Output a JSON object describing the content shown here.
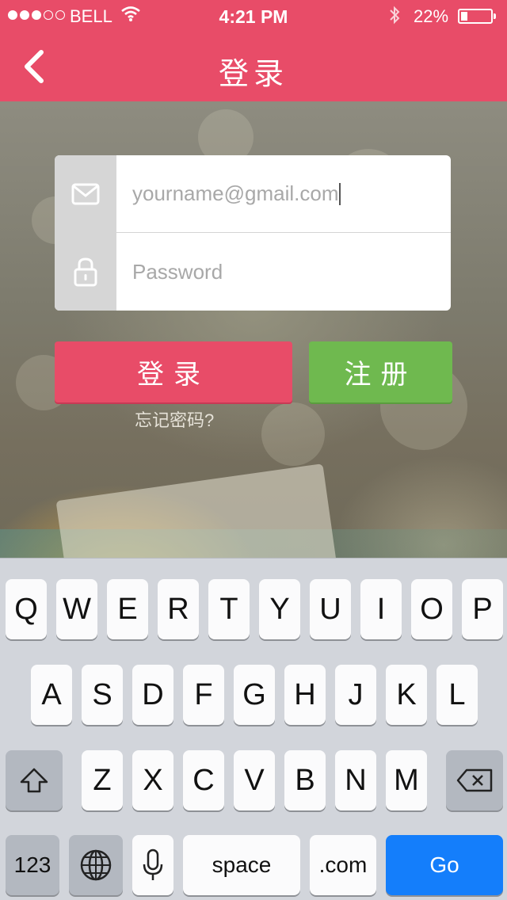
{
  "status_bar": {
    "carrier": "BELL",
    "time": "4:21 PM",
    "battery_percent": "22%",
    "battery_level": 0.22,
    "signal_bars_filled": 3,
    "signal_bars_total": 5,
    "icons": [
      "wifi-icon",
      "bluetooth-icon",
      "battery-icon"
    ]
  },
  "nav": {
    "title": "登录",
    "back_icon": "chevron-left-icon"
  },
  "form": {
    "email": {
      "icon": "envelope-icon",
      "placeholder": "yourname@gmail.com"
    },
    "password": {
      "icon": "lock-icon",
      "placeholder": "Password"
    },
    "login_label": "登录",
    "register_label": "注册",
    "forgot_label": "忘记密码?"
  },
  "keyboard": {
    "row1": [
      "Q",
      "W",
      "E",
      "R",
      "T",
      "Y",
      "U",
      "I",
      "O",
      "P"
    ],
    "row2": [
      "A",
      "S",
      "D",
      "F",
      "G",
      "H",
      "J",
      "K",
      "L"
    ],
    "row3": [
      "Z",
      "X",
      "C",
      "V",
      "B",
      "N",
      "M"
    ],
    "shift_icon": "shift-icon",
    "delete_icon": "backspace-icon",
    "numbers_label": "123",
    "globe_icon": "globe-icon",
    "mic_icon": "microphone-icon",
    "space_label": "space",
    "dotcom_label": ".com",
    "go_label": "Go"
  },
  "colors": {
    "brand": "#e84c68",
    "register": "#6fb94f",
    "go_key": "#147efb"
  }
}
